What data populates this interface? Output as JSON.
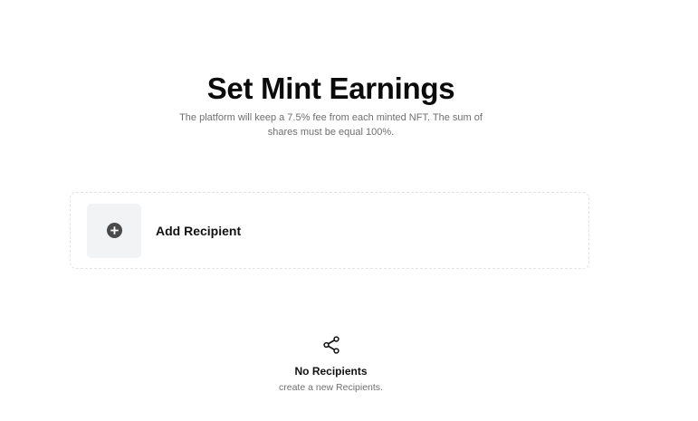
{
  "header": {
    "title": "Set Mint Earnings",
    "subtitle": "The platform will keep a 7.5% fee from each minted NFT. The sum of shares must be equal 100%."
  },
  "add_recipient": {
    "label": "Add Recipient",
    "icon": "plus-circle-icon"
  },
  "empty_state": {
    "icon": "share-icon",
    "title": "No Recipients",
    "subtitle": "create a new Recipients."
  }
}
